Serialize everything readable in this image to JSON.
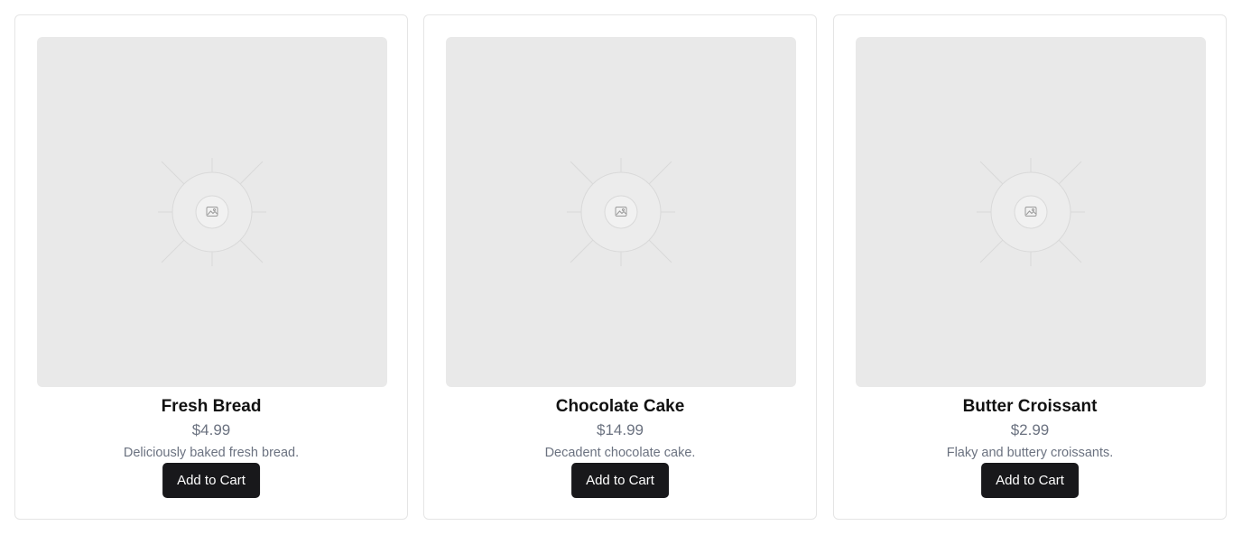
{
  "products": [
    {
      "name": "Fresh Bread",
      "price": "$4.99",
      "description": "Deliciously baked fresh bread.",
      "button_label": "Add to Cart",
      "image_icon": "image-placeholder-icon"
    },
    {
      "name": "Chocolate Cake",
      "price": "$14.99",
      "description": "Decadent chocolate cake.",
      "button_label": "Add to Cart",
      "image_icon": "image-placeholder-icon"
    },
    {
      "name": "Butter Croissant",
      "price": "$2.99",
      "description": "Flaky and buttery croissants.",
      "button_label": "Add to Cart",
      "image_icon": "image-placeholder-icon"
    }
  ],
  "colors": {
    "button_bg": "#18181b",
    "button_text": "#ffffff",
    "placeholder_bg": "#e9e9e9",
    "muted_text": "#6b7280",
    "card_border": "#e5e5e5"
  }
}
